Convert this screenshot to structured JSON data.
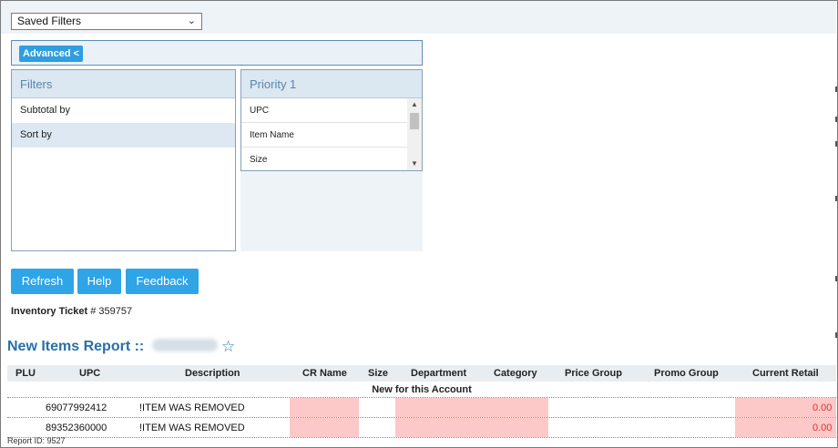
{
  "saved_filters": {
    "label": "Saved Filters"
  },
  "advanced": {
    "label": "Advanced <"
  },
  "filters_panel": {
    "header": "Filters",
    "items": [
      {
        "label": "Subtotal by",
        "selected": false
      },
      {
        "label": "Sort by",
        "selected": true
      }
    ]
  },
  "priority_panel": {
    "header": "Priority 1",
    "items": [
      "UPC",
      "Item Name",
      "Size"
    ]
  },
  "buttons": {
    "refresh": "Refresh",
    "help": "Help",
    "feedback": "Feedback"
  },
  "ticket": {
    "label": "Inventory Ticket",
    "value": "# 359757"
  },
  "report": {
    "title": "New Items Report ::"
  },
  "table": {
    "columns": [
      "PLU",
      "UPC",
      "Description",
      "CR Name",
      "Size",
      "Department",
      "Category",
      "Price Group",
      "Promo Group",
      "Current Retail"
    ],
    "group_label": "New for this Account",
    "rows": [
      {
        "plu": "",
        "upc": "69077992412",
        "description": "!ITEM WAS REMOVED",
        "current_retail": "0.00"
      },
      {
        "plu": "",
        "upc": "89352360000",
        "description": "!ITEM WAS REMOVED",
        "current_retail": "0.00"
      }
    ]
  },
  "footer": {
    "report_id": "Report ID: 9527"
  },
  "colors": {
    "accent": "#2fa4e7",
    "title": "#2a6fa8",
    "highlight": "#fdc8c8",
    "retail": "#dd3333"
  }
}
